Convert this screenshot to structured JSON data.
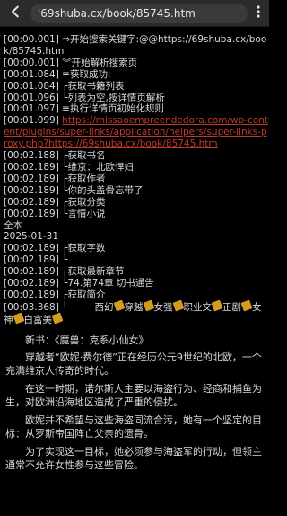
{
  "browser": {
    "url": "'69shuba.cx/book/85745.htm"
  },
  "log": [
    {
      "text": "[00:00.001] ⇒开始搜索关键字:@@https://69shuba.cx/book/85745.htm"
    },
    {
      "text": "[00:00.001] ︾开始解析搜索页"
    },
    {
      "text": "[00:01.084] ≡获取成功:"
    },
    {
      "text": "[00:01.084] ┌获取书籍列表"
    },
    {
      "text": "[00:01.096] └列表为空,按详情页解析"
    },
    {
      "text": "[00:01.097] ≡执行详情页初始化规则"
    },
    {
      "text": "[00:01.099] ",
      "link": "https://missaoempreendedora.com/wp-content/plugins/super-links/application/helpers/super-links-proxy.php?https://69shuba.cx/book/85745.htm"
    },
    {
      "text": "[00:02.188] ┌获取书名"
    },
    {
      "text": "[00:02.189] └维京：北欧悍妇"
    },
    {
      "text": "[00:02.189] ┌获取作者"
    },
    {
      "text": "[00:02.189] └你的头盖骨忘带了"
    },
    {
      "text": "[00:02.189] ┌获取分类"
    },
    {
      "text": "[00:02.189] └言情小说"
    },
    {
      "text": "全本"
    },
    {
      "text": "2025-01-31"
    },
    {
      "text": "[00:02.189] ┌获取字数"
    },
    {
      "text": "[00:02.189] └"
    },
    {
      "text": "[00:02.189] ┌获取最新章节"
    },
    {
      "text": "[00:02.189] └74.第74章 切书通告"
    },
    {
      "text": "[00:02.189] ┌获取简介"
    },
    {
      "text": "[00:03.368] └",
      "tags": [
        "西幻",
        "穿越",
        "女强",
        "职业文",
        "正剧",
        "女神",
        "白富美"
      ]
    }
  ],
  "intro": {
    "title": "新书：《魔兽：克系小仙女》",
    "paragraphs": [
      "穿越者“欧妮·费尔德”正在经历公元9世纪的北欧，一个充满维京人传奇的时代。",
      "在这一时期，诺尔斯人主要以海盗行为、经商和捕鱼为生，对欧洲沿海地区造成了严重的侵扰。",
      "欧妮并不希望与这些海盗同流合污，她有一个坚定的目标：从罗斯帝国阵亡父亲的遗骨。",
      "为了实现这一目标，她必须参与海盗军的行动，但领主通常不允许女性参与这些冒险。"
    ]
  }
}
